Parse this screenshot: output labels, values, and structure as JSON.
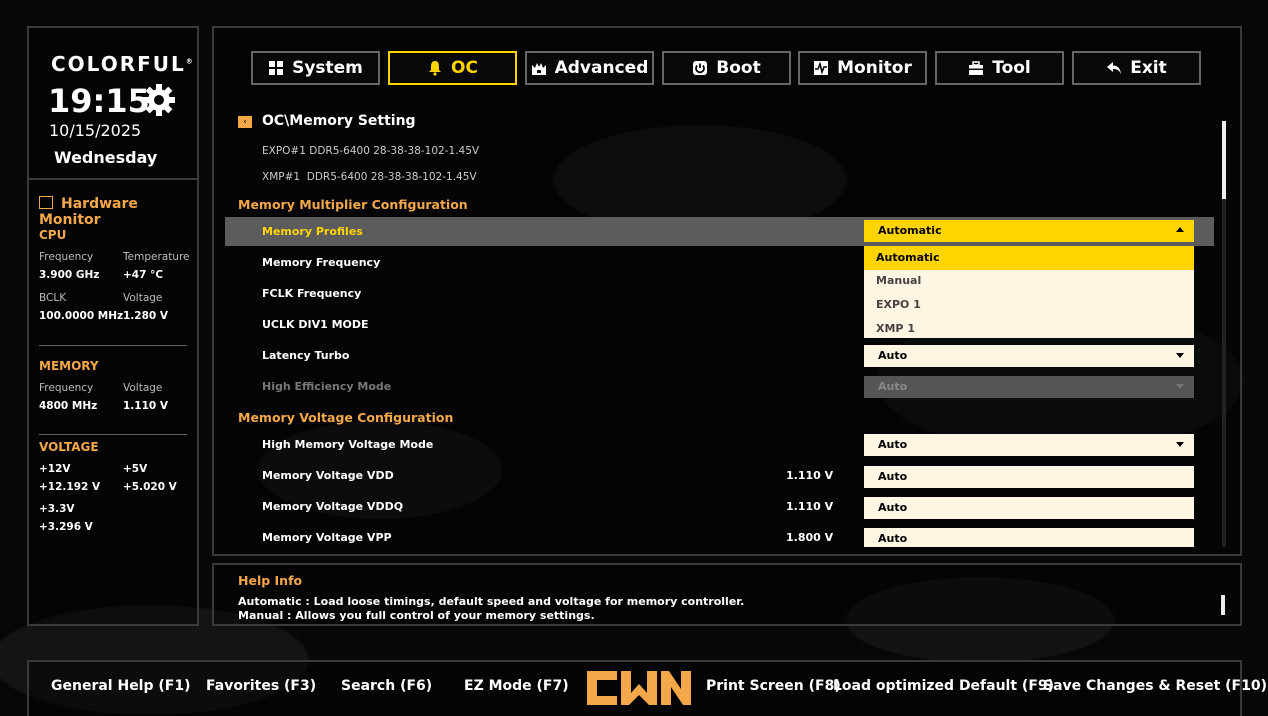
{
  "brand": {
    "logo": "COLORFUL",
    "reg": "®"
  },
  "clock": {
    "time": "19:15",
    "date": "10/15/2025",
    "day": "Wednesday"
  },
  "hardware_monitor": {
    "title": "Hardware Monitor",
    "cpu": {
      "title": "CPU",
      "freq_label": "Frequency",
      "freq": "3.900 GHz",
      "temp_label": "Temperature",
      "temp": "+47 °C",
      "bclk_label": "BCLK",
      "bclk": "100.0000 MHz",
      "volt_label": "Voltage",
      "volt": "1.280 V"
    },
    "memory": {
      "title": "MEMORY",
      "freq_label": "Frequency",
      "freq": "4800 MHz",
      "volt_label": "Voltage",
      "volt": "1.110 V"
    },
    "voltage": {
      "title": "VOLTAGE",
      "v12_label": "+12V",
      "v12": "+12.192 V",
      "v5_label": "+5V",
      "v5": "+5.020 V",
      "v33_label": "+3.3V",
      "v33": "+3.296 V"
    }
  },
  "tabs": [
    "System",
    "OC",
    "Advanced",
    "Boot",
    "Monitor",
    "Tool",
    "Exit"
  ],
  "breadcrumb": "OC\\Memory Setting",
  "info_lines": [
    "EXPO#1 DDR5-6400 28-38-38-102-1.45V",
    "XMP#1  DDR5-6400 28-38-38-102-1.45V"
  ],
  "groups": [
    "Memory Multiplier Configuration",
    "Memory Voltage Configuration"
  ],
  "items": [
    {
      "label": "Memory Profiles",
      "value": "",
      "select": "Automatic"
    },
    {
      "label": "Memory Frequency",
      "value": "",
      "select": ""
    },
    {
      "label": "FCLK Frequency",
      "value": "",
      "select": ""
    },
    {
      "label": "UCLK DIV1 MODE",
      "value": "",
      "select": ""
    },
    {
      "label": "Latency Turbo",
      "value": "",
      "select": "Auto"
    },
    {
      "label": "High Efficiency Mode",
      "value": "",
      "select": "Auto"
    },
    {
      "label": "High Memory Voltage Mode",
      "value": "",
      "select": "Auto"
    },
    {
      "label": "Memory Voltage VDD",
      "value": "1.110 V",
      "select": "Auto"
    },
    {
      "label": "Memory Voltage VDDQ",
      "value": "1.110 V",
      "select": "Auto"
    },
    {
      "label": "Memory Voltage VPP",
      "value": "1.800 V",
      "select": "Auto"
    }
  ],
  "dropdown_options": [
    "Automatic",
    "Manual",
    "EXPO 1",
    "XMP 1"
  ],
  "help": {
    "title": "Help Info",
    "lines": [
      "Automatic : Load loose timings, default speed and voltage for memory controller.",
      "Manual : Allows you full control of your memory settings."
    ]
  },
  "footer": {
    "general_help": "General Help (F1)",
    "favorites": "Favorites (F3)",
    "search": "Search (F6)",
    "ez_mode": "EZ Mode (F7)",
    "print_screen": "Print Screen (F8)",
    "load_default": "Load optimized Default (F9)",
    "save_reset": "Save Changes & Reset (F10)"
  },
  "colors": {
    "accent": "#ffd400",
    "orange": "#f5a84a",
    "field_bg": "#fff5e3"
  }
}
